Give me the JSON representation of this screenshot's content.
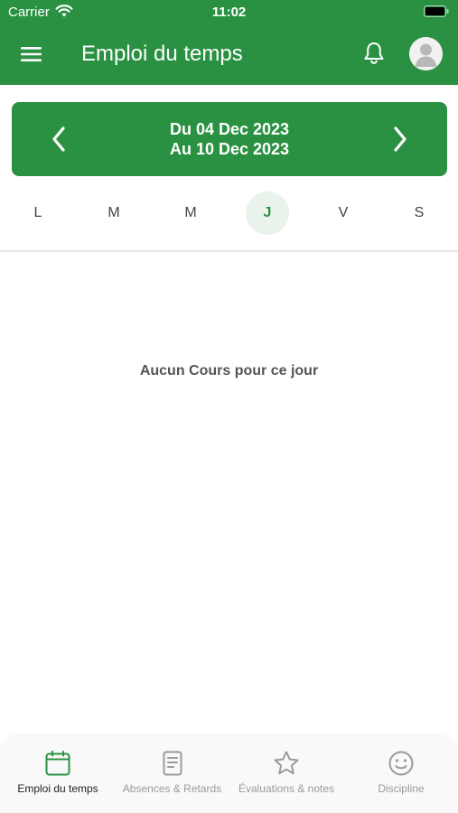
{
  "status_bar": {
    "carrier": "Carrier",
    "time": "11:02"
  },
  "app_bar": {
    "title": "Emploi du temps",
    "menu_icon": "menu-icon",
    "bell_icon": "bell-icon",
    "avatar_icon": "user-avatar-icon"
  },
  "week": {
    "line1": "Du 04 Dec 2023",
    "line2": "Au 10 Dec 2023"
  },
  "days": [
    {
      "label": "L",
      "selected": false
    },
    {
      "label": "M",
      "selected": false
    },
    {
      "label": "M",
      "selected": false
    },
    {
      "label": "J",
      "selected": true
    },
    {
      "label": "V",
      "selected": false
    },
    {
      "label": "S",
      "selected": false
    }
  ],
  "empty_message": "Aucun Cours pour ce jour",
  "tabs": [
    {
      "label": "Emploi du temps",
      "icon": "calendar-icon",
      "active": true
    },
    {
      "label": "Absences & Retards",
      "icon": "document-icon",
      "active": false
    },
    {
      "label": "Évaluations & notes",
      "icon": "star-icon",
      "active": false
    },
    {
      "label": "Discipline",
      "icon": "smiley-icon",
      "active": false
    }
  ],
  "colors": {
    "brand_green": "#2a9142",
    "selected_day_bg": "#e9f3ec",
    "inactive_tab": "#9a9a9a"
  }
}
